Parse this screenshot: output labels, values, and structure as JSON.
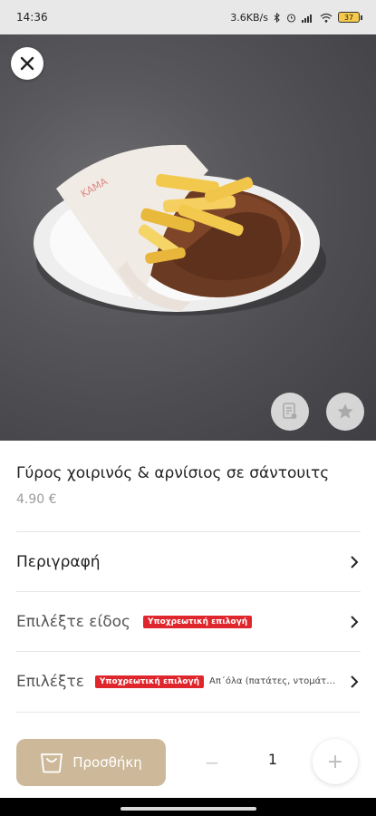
{
  "status_bar": {
    "time": "14:36",
    "network_speed": "3.6KB/s",
    "battery_level": "37",
    "wifi_label": "Vo WiFi",
    "icons": [
      "bluetooth-icon",
      "alarm-icon",
      "signal-icon",
      "wifi-icon",
      "battery-icon"
    ]
  },
  "hero": {
    "close_icon": "close-icon",
    "doc_icon": "document-icon",
    "star_icon": "star-icon"
  },
  "product": {
    "title": "Γύρος χοιρινός & αρνίσιος σε σάντουιτς",
    "price": "4.90 €"
  },
  "options": [
    {
      "label": "Περιγραφή"
    },
    {
      "label": "Επιλέξτε είδος",
      "badge": "Υποχρεωτική επιλογή"
    },
    {
      "label": "Επιλέξτε",
      "badge": "Υποχρεωτική επιλογή",
      "extra": "Απ΄όλα (πατάτες, ντομάτα,..."
    }
  ],
  "cart": {
    "add_label": "Προσθήκη",
    "minus": "−",
    "quantity": "1",
    "plus": "+"
  },
  "colors": {
    "accent": "#cdb99a",
    "required_badge": "#e0262d"
  }
}
